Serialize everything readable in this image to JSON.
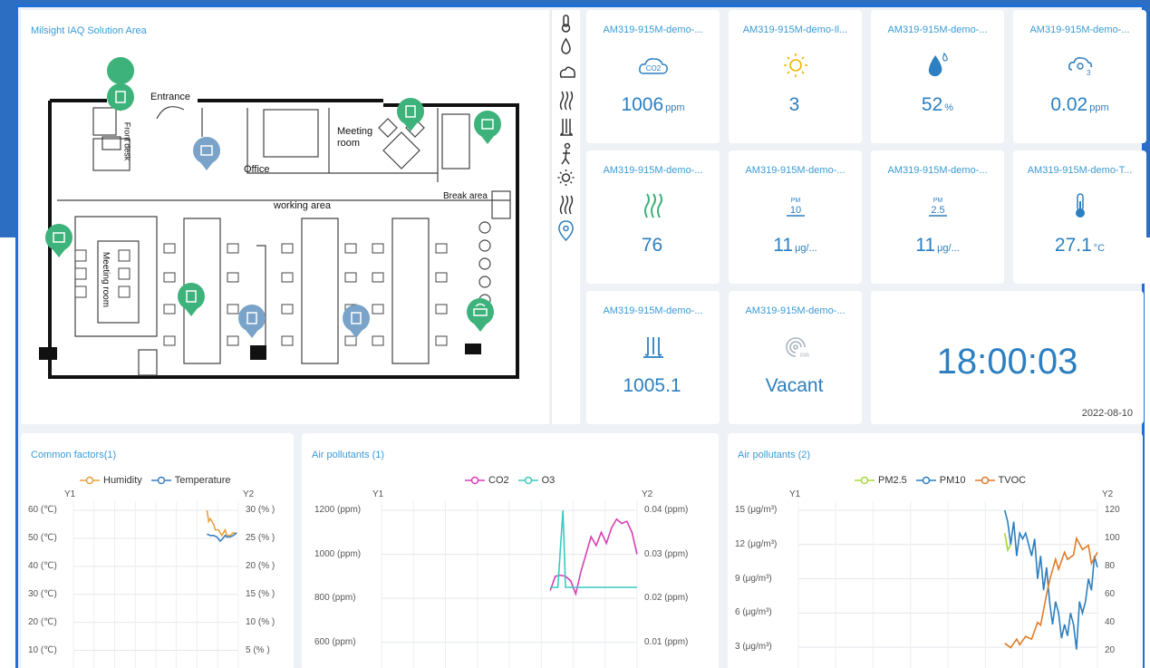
{
  "floor_plan": {
    "title": "Milsight IAQ Solution Area",
    "labels": {
      "entrance": "Entrance",
      "front_desk": "Front desk",
      "meeting_room_1": "Meeting room",
      "office": "Office",
      "working_area": "working area",
      "break_area": "Break area",
      "meeting_room_2": "Meeting room"
    }
  },
  "icon_bar": [
    "thermometer-icon",
    "humidity-drop-icon",
    "co2-cloud-icon",
    "tvoc-waves-icon",
    "pressure-icon",
    "occupancy-person-icon",
    "light-sun-icon",
    "waves-icon",
    "location-pin-icon"
  ],
  "tiles": [
    {
      "name": "AM319-915M-demo-...",
      "icon": "co2-cloud-icon",
      "value": "1006",
      "unit": "ppm"
    },
    {
      "name": "AM319-915M-demo-Il...",
      "icon": "sun-icon",
      "value": "3",
      "unit": ""
    },
    {
      "name": "AM319-915M-demo-...",
      "icon": "humidity-drop-icon",
      "value": "52",
      "unit": "%"
    },
    {
      "name": "AM319-915M-demo-...",
      "icon": "o3-cloud-icon",
      "value": "0.02",
      "unit": "ppm"
    },
    {
      "name": "AM319-915M-demo-...",
      "icon": "tvoc-waves-icon",
      "value": "76",
      "unit": ""
    },
    {
      "name": "AM319-915M-demo-...",
      "icon": "pm10-icon",
      "value": "11",
      "unit": "μg/..."
    },
    {
      "name": "AM319-915M-demo-...",
      "icon": "pm25-icon",
      "value": "11",
      "unit": "μg/..."
    },
    {
      "name": "AM319-915M-demo-T...",
      "icon": "thermometer-icon",
      "value": "27.1",
      "unit": "°C"
    },
    {
      "name": "AM319-915M-demo-...",
      "icon": "pressure-icon",
      "value": "1005.1",
      "unit": ""
    },
    {
      "name": "AM319-915M-demo-...",
      "icon": "pir-icon",
      "value": "Vacant",
      "unit": ""
    }
  ],
  "clock": {
    "time": "18:00:03",
    "date": "2022-08-10"
  },
  "colors": {
    "accent": "#2c7fc0",
    "humidity": "#e6a23c",
    "temperature": "#3a7fc0",
    "co2": "#d63fb5",
    "o3": "#3cc9c0",
    "pm25": "#a6d83a",
    "pm10": "#2c7fc0",
    "tvoc": "#e07b28"
  },
  "chart_data": [
    {
      "type": "line",
      "title": "Common factors(1)",
      "y1_label": "Y1",
      "y2_label": "Y2",
      "y1_ticks": [
        "60 (℃)",
        "50 (℃)",
        "40 (℃)",
        "30 (℃)",
        "20 (℃)",
        "10 (℃)"
      ],
      "y2_ticks": [
        "30 (% )",
        "25 (% )",
        "20 (% )",
        "15 (% )",
        "10 (% )",
        "5 (% )"
      ],
      "y1lim": [
        5,
        60
      ],
      "y2lim": [
        2.5,
        30
      ],
      "series": [
        {
          "name": "Humidity",
          "axis": "y2",
          "x": [
            0.81,
            0.82,
            0.83,
            0.85,
            0.86,
            0.88,
            0.9,
            0.92,
            0.93,
            0.95,
            0.97,
            0.99
          ],
          "values": [
            30,
            28,
            28.5,
            27.5,
            26.5,
            26.5,
            25.5,
            26.5,
            25.5,
            25.5,
            26,
            25.8
          ]
        },
        {
          "name": "Temperature",
          "axis": "y1",
          "x": [
            0.81,
            0.83,
            0.85,
            0.87,
            0.89,
            0.9,
            0.92,
            0.93,
            0.95,
            0.97,
            0.99
          ],
          "values": [
            51.5,
            51,
            51,
            50.5,
            49,
            49.5,
            51,
            50.5,
            50.5,
            51,
            52
          ]
        }
      ]
    },
    {
      "type": "line",
      "title": "Air pollutants (1)",
      "y1_label": "Y1",
      "y2_label": "Y2",
      "y1_ticks": [
        "1200 (ppm)",
        "1000 (ppm)",
        "800 (ppm)",
        "600 (ppm)"
      ],
      "y2_ticks": [
        "0.04 (ppm)",
        "0.03 (ppm)",
        "0.02 (ppm)",
        "0.01 (ppm)"
      ],
      "y1lim": [
        500,
        1200
      ],
      "y2lim": [
        0,
        0.04
      ],
      "series": [
        {
          "name": "CO2",
          "axis": "y1",
          "x": [
            0.66,
            0.68,
            0.7,
            0.72,
            0.74,
            0.76,
            0.78,
            0.8,
            0.82,
            0.84,
            0.86,
            0.88,
            0.9,
            0.92,
            0.94,
            0.96,
            0.98,
            1.0
          ],
          "values": [
            835,
            900,
            905,
            900,
            880,
            820,
            920,
            1000,
            1080,
            1040,
            1100,
            1050,
            1120,
            1160,
            1140,
            1150,
            1100,
            1000
          ]
        },
        {
          "name": "O3",
          "axis": "y2",
          "x": [
            0.66,
            0.69,
            0.71,
            0.72,
            0.74,
            1.0
          ],
          "values": [
            0.02,
            0.02,
            0.04,
            0.02,
            0.02,
            0.02
          ]
        }
      ]
    },
    {
      "type": "line",
      "title": "Air pollutants (2)",
      "y1_label": "Y1",
      "y2_label": "Y2",
      "y1_ticks": [
        "15 (μg/m³)",
        "12 (μg/m³)",
        "9 (μg/m³)",
        "6 (μg/m³)",
        "3 (μg/m³)"
      ],
      "y2_ticks": [
        "120",
        "100",
        "80",
        "60",
        "40",
        "20"
      ],
      "y1lim": [
        1.5,
        15
      ],
      "y2lim": [
        10,
        120
      ],
      "series": [
        {
          "name": "PM2.5",
          "axis": "y1",
          "x": [
            0.69,
            0.7,
            0.71
          ],
          "values": [
            13,
            11.5,
            12
          ]
        },
        {
          "name": "PM10",
          "axis": "y1",
          "x": [
            0.69,
            0.7,
            0.71,
            0.72,
            0.73,
            0.74,
            0.75,
            0.76,
            0.77,
            0.78,
            0.79,
            0.8,
            0.81,
            0.82,
            0.83,
            0.84,
            0.85,
            0.86,
            0.87,
            0.88,
            0.89,
            0.9,
            0.91,
            0.92,
            0.93,
            0.94,
            0.95,
            0.96,
            0.97,
            0.98,
            0.99,
            1.0
          ],
          "values": [
            15,
            14,
            12,
            14,
            11,
            13,
            12.5,
            13,
            12,
            11,
            12.5,
            9,
            11,
            8,
            10,
            7,
            5,
            7,
            6,
            3.8,
            5,
            4,
            6,
            5,
            2.8,
            7,
            6,
            7,
            9,
            8,
            11,
            10
          ]
        },
        {
          "name": "TVOC",
          "axis": "y2",
          "x": [
            0.69,
            0.71,
            0.73,
            0.74,
            0.76,
            0.78,
            0.8,
            0.81,
            0.83,
            0.84,
            0.86,
            0.87,
            0.89,
            0.9,
            0.92,
            0.93,
            0.95,
            0.97,
            0.98,
            1.0
          ],
          "values": [
            25,
            22,
            28,
            24,
            30,
            28,
            40,
            38,
            60,
            70,
            85,
            78,
            90,
            85,
            88,
            100,
            92,
            95,
            82,
            90
          ]
        }
      ]
    }
  ],
  "chart_legends": [
    [
      {
        "name": "Humidity",
        "color": "#e6a23c"
      },
      {
        "name": "Temperature",
        "color": "#3a7fc0"
      }
    ],
    [
      {
        "name": "CO2",
        "color": "#d63fb5"
      },
      {
        "name": "O3",
        "color": "#3cc9c0"
      }
    ],
    [
      {
        "name": "PM2.5",
        "color": "#a6d83a"
      },
      {
        "name": "PM10",
        "color": "#2c7fc0"
      },
      {
        "name": "TVOC",
        "color": "#e07b28"
      }
    ]
  ]
}
